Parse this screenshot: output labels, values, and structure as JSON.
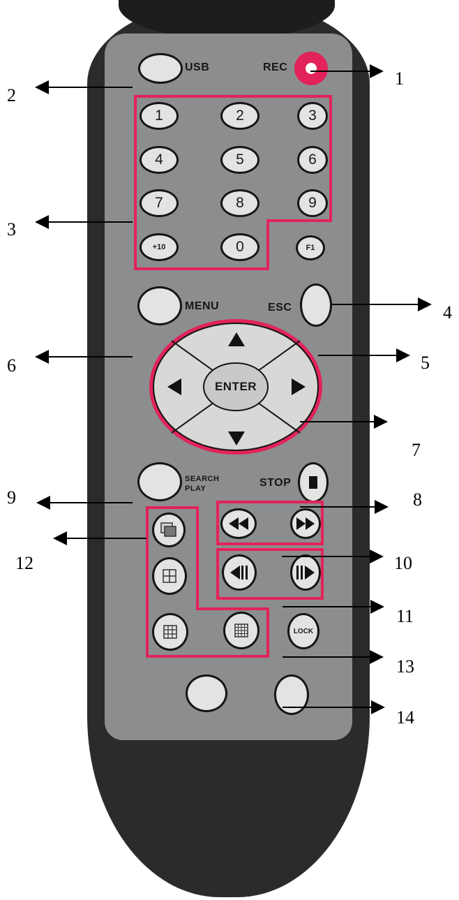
{
  "remote": {
    "silkscreen": {
      "usb": "USB",
      "rec": "REC",
      "menu": "MENU",
      "esc": "ESC",
      "search_play_1": "SEARCH",
      "search_play_2": "PLAY",
      "stop": "STOP"
    },
    "digits": [
      "1",
      "2",
      "3",
      "4",
      "5",
      "6",
      "7",
      "8",
      "9",
      "+10",
      "0",
      "F1"
    ],
    "enter": "ENTER",
    "lock": "LOCK"
  },
  "callouts": [
    "1",
    "2",
    "3",
    "4",
    "5",
    "6",
    "7",
    "8",
    "9",
    "10",
    "11",
    "12",
    "13",
    "14"
  ],
  "colors": {
    "body": "#2b2b2d",
    "panel": "#8c8d8f",
    "button": "#e3e3e1",
    "highlight": "#e2235a",
    "rec_button": "#e2235a"
  },
  "icons": {
    "up": "triangle-up-icon",
    "down": "triangle-down-icon",
    "left": "triangle-left-icon",
    "right": "triangle-right-icon",
    "stop": "stop-square-icon",
    "rewind": "rewind-icon",
    "fast_forward": "fast-forward-icon",
    "step_back": "step-back-icon",
    "step_forward": "step-forward-icon",
    "single_screen": "single-screen-icon",
    "quad_screen": "quad-screen-icon",
    "nine_screen": "nine-screen-icon",
    "sixteen_screen": "sixteen-screen-icon"
  }
}
